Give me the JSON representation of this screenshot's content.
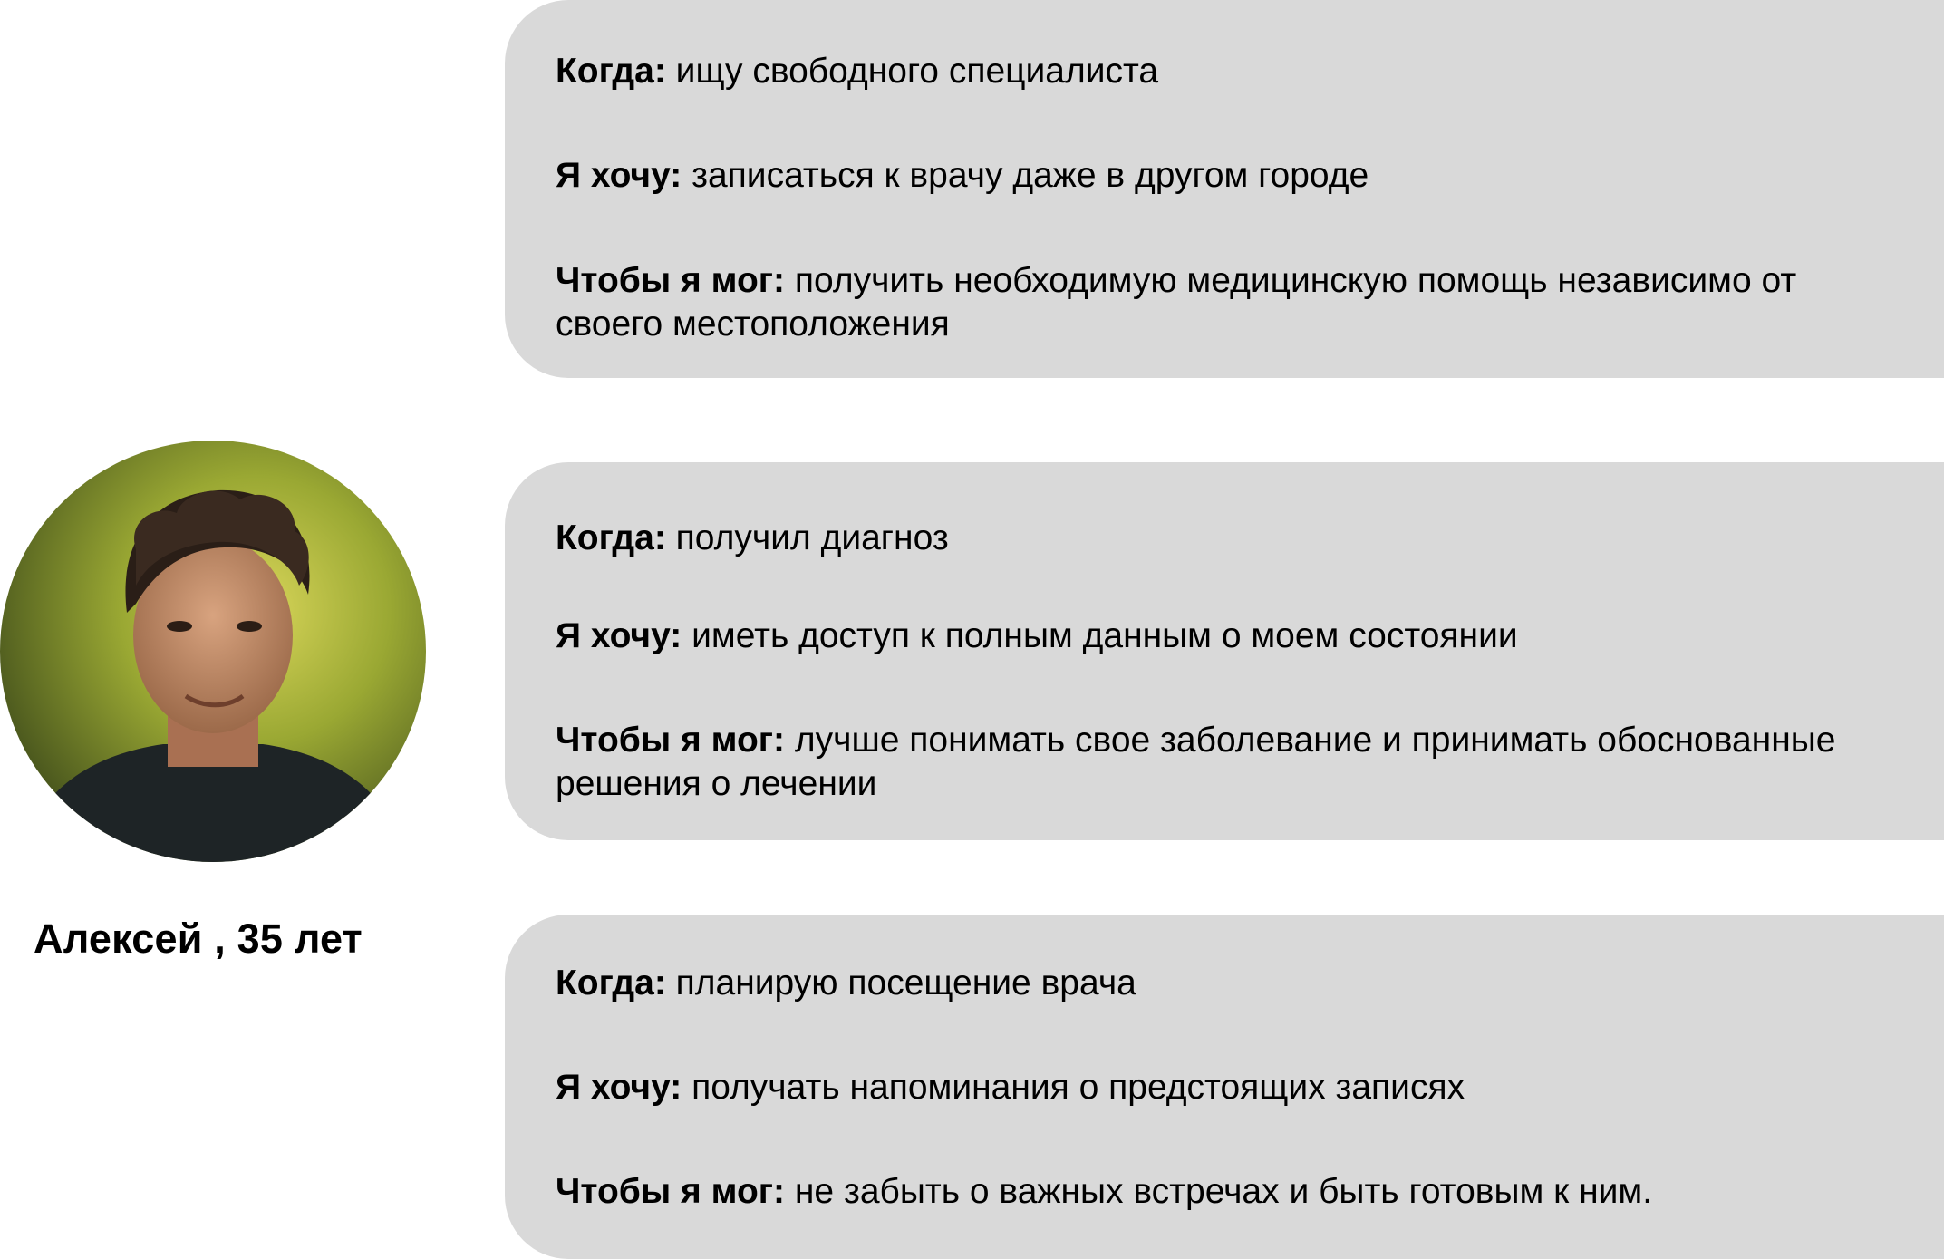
{
  "persona": {
    "name": "Алексей , 35 лет",
    "photo_icon": "person-photo"
  },
  "cards": [
    {
      "when_label": "Когда:",
      "when_text": "ищу свободного специалиста",
      "want_label": "Я хочу:",
      "want_text": "записаться к врачу даже в другом городе",
      "so_label": "Чтобы я мог:",
      "so_text": "получить необходимую медицинскую помощь независимо от своего местоположения"
    },
    {
      "when_label": "Когда:",
      "when_text": "получил диагноз",
      "want_label": "Я хочу:",
      "want_text": "иметь доступ к полным данным о моем состоянии",
      "so_label": "Чтобы я мог:",
      "so_text": "лучше понимать свое заболевание и принимать обоснованные решения о лечении"
    },
    {
      "when_label": "Когда:",
      "when_text": "планирую посещение врача",
      "want_label": "Я хочу:",
      "want_text": "получать напоминания о предстоящих записях",
      "so_label": "Чтобы я мог:",
      "so_text": "не забыть о важных встречах и быть готовым к ним."
    }
  ]
}
